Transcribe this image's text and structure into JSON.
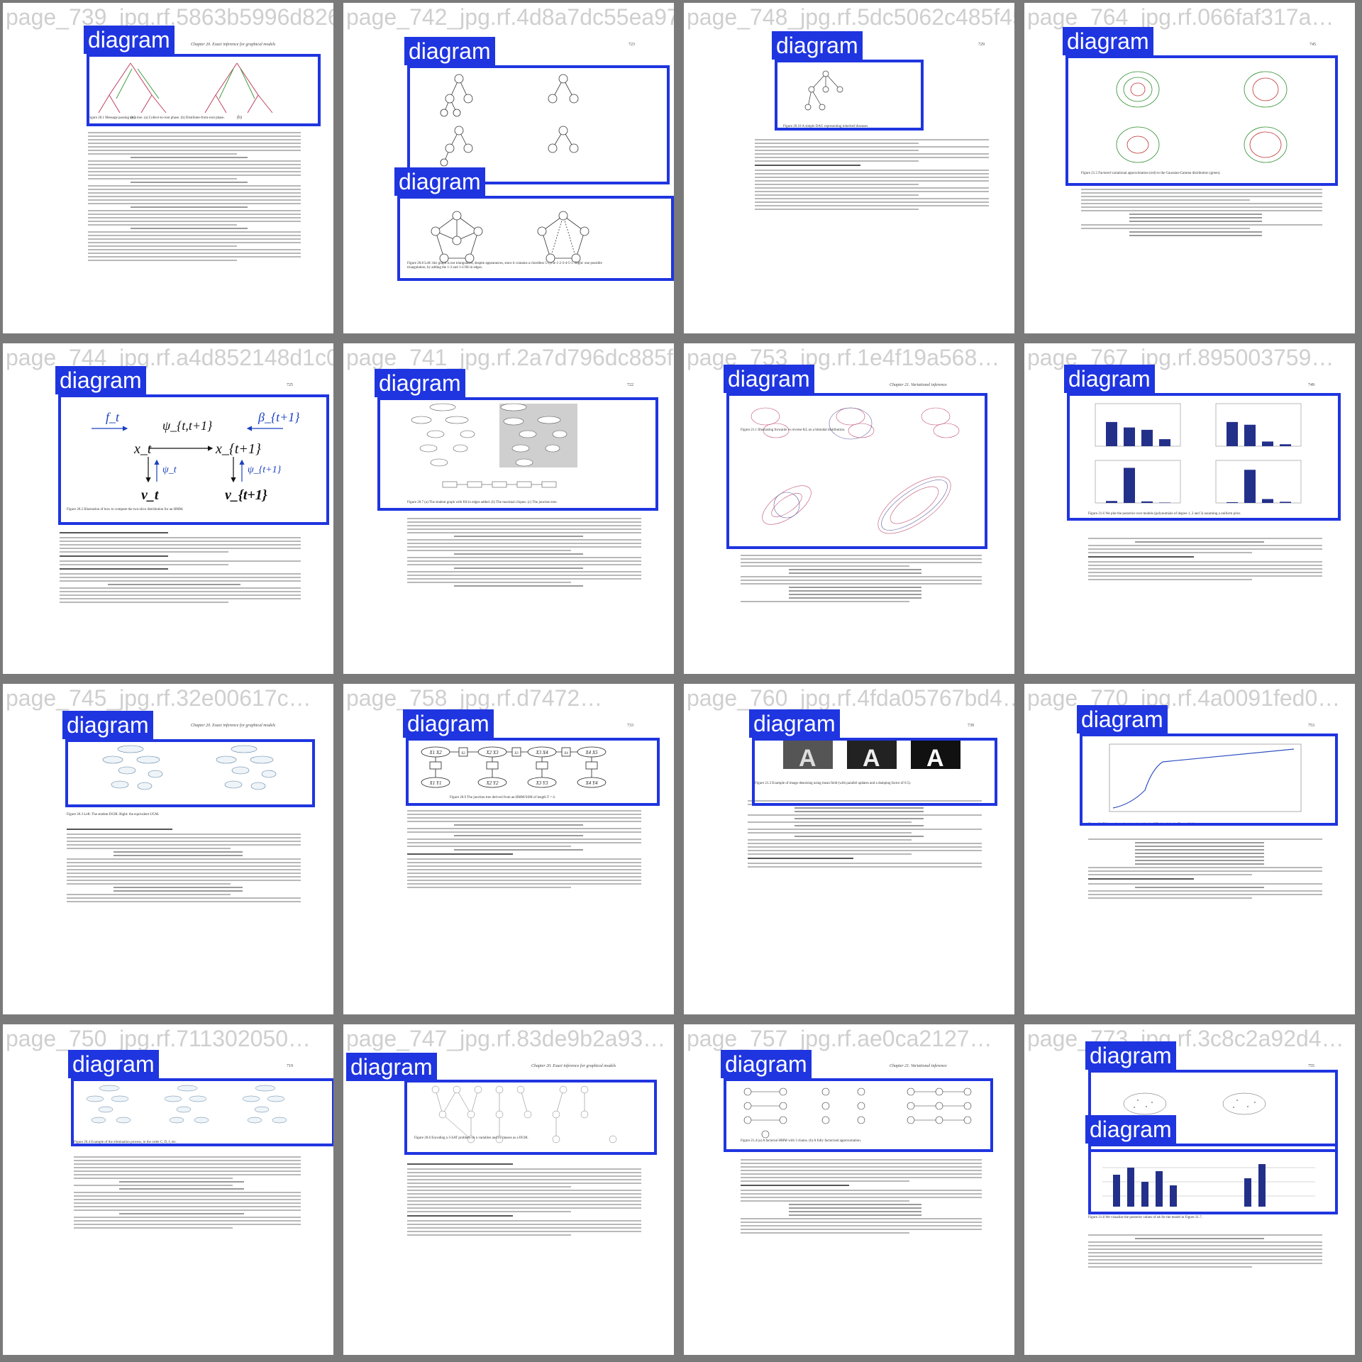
{
  "label_text": "diagram",
  "tiles": [
    {
      "filename": "page_739_jpg.rf.5863b5996d826651…",
      "header": "Chapter 20.   Exact inference for graphical models",
      "page": "",
      "caption": "Figure 20.1  Message passing on a tree. (a) Collect-to-root phase. (b) Distribute-from-root phase."
    },
    {
      "filename": "page_742_jpg.rf.4d8a7dc55ea97c…",
      "header": "",
      "page": "723",
      "caption": "Figure 20.8  Left: this graph is not triangulated, despite appearances, since it contains a chordless 5-cycle 1-2-3-4-5-1. Right: one possible triangulation, by adding the 1-3 and 1-4 fill-in edges."
    },
    {
      "filename": "page_748_jpg.rf.5dc5062c485f45b643…",
      "header": "",
      "page": "729",
      "caption": "Figure 20.10  A simple DAG representing inherited diseases."
    },
    {
      "filename": "page_764_jpg.rf.066faf317a…",
      "header": "",
      "page": "745",
      "caption": "Figure 21.5  Factored variational approximation (red) to the Gaussian-Gamma distribution (green)."
    },
    {
      "filename": "page_744_jpg.rf.a4d852148d1c034…",
      "header": "",
      "page": "725",
      "caption": "Figure 20.2  Illustration of how to compute the two-slice distribution for an HMM."
    },
    {
      "filename": "page_741_jpg.rf.2a7d796dc885f1da…",
      "header": "",
      "page": "722",
      "caption": "Figure 20.7  (a) The student graph with fill-in edges added. (b) The maximal cliques. (c) The junction tree."
    },
    {
      "filename": "page_753_jpg.rf.1e4f19a568…",
      "header": "Chapter 21.   Variational inference",
      "page": "",
      "caption": "Figure 21.1  Illustrating forwards vs reverse KL on a bimodal distribution."
    },
    {
      "filename": "page_767_jpg.rf.895003759…",
      "header": "",
      "page": "749",
      "caption": "Figure 21.6  We plot the posterior over models (polynomials of degree 1, 2 and 3) assuming a uniform prior."
    },
    {
      "filename": "page_745_jpg.rf.32e00617c…",
      "header": "Chapter 20.   Exact inference for graphical models",
      "page": "",
      "caption": "Figure 20.3  Left: The student DGM. Right: the equivalent UGM."
    },
    {
      "filename": "page_758_jpg.rf.d7472…",
      "header": "",
      "page": "733",
      "caption": "Figure 20.9  The junction tree derived from an HMM/SSM of length T = 4."
    },
    {
      "filename": "page_760_jpg.rf.4fda05767bd4…",
      "header": "",
      "page": "739",
      "caption": "Figure 21.3  Example of image denoising using mean field (with parallel updates and a damping factor of 0.5)."
    },
    {
      "filename": "page_770_jpg.rf.4a0091fed0…",
      "header": "",
      "page": "753",
      "caption": "Figure 21.7  Lower bound vs iterations for the VB algorithm in Figure 21.8."
    },
    {
      "filename": "page_750_jpg.rf.711302050…",
      "header": "",
      "page": "719",
      "caption": "Figure 20.4  Example of the elimination process, in the order C, D, I, etc."
    },
    {
      "filename": "page_747_jpg.rf.83de9b2a93…",
      "header": "Chapter 20.   Exact inference for graphical models",
      "page": "",
      "caption": "Figure 20.6  Encoding a 3-SAT problem on n variables and m clauses as a DGM."
    },
    {
      "filename": "page_757_jpg.rf.ae0ca2127…",
      "header": "Chapter 21.   Variational inference",
      "page": "",
      "caption": "Figure 21.4  (a) A factorial HMM with 3 chains. (b) A fully factorized approximation."
    },
    {
      "filename": "page_773_jpg.rf.3c8c2a92d4…",
      "header": "",
      "page": "755",
      "caption": "Figure 21.8  We visualize the posterior values of αk for the model in Figure 21.7."
    }
  ],
  "hmm_labels": {
    "f": "f_t",
    "psi_edge": "ψ_{t,t+1}",
    "beta": "β_{t+1}",
    "xt": "x_t",
    "xt1": "x_{t+1}",
    "psit": "ψ_t",
    "psit1": "ψ_{t+1}",
    "vt": "v_t",
    "vt1": "v_{t+1}"
  },
  "junction_tree": {
    "top": [
      "X1 X2",
      "X2 X3",
      "X3 X4",
      "X4 X5"
    ],
    "bottom": [
      "X1 Y1",
      "X2 Y2",
      "X3 Y3",
      "X4 Y4"
    ],
    "sep": [
      "X2",
      "X3",
      "X4"
    ]
  },
  "bar_chart": {
    "bars": [
      0.62,
      0.48,
      0.42,
      0.18
    ]
  }
}
